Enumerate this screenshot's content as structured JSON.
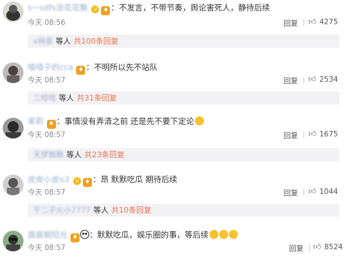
{
  "comments": [
    {
      "username": "s一sdfs涂花花飘",
      "text": "不发言，不带节奏，舆论害死人，静待后续",
      "time": "今天 08:56",
      "reply": "回复",
      "likes": "4275",
      "sub": {
        "name": "x林泉",
        "deng": "等人",
        "total": "共100条回复"
      }
    },
    {
      "username": "嘻嘻子的cca",
      "text": "不明所以先不站队",
      "time": "今天 08:57",
      "reply": "回复",
      "likes": "2534",
      "sub": {
        "name": "二哈哈",
        "deng": "等人",
        "total": "共31条回复"
      }
    },
    {
      "username": "茉莉",
      "text": "事情没有弄清之前 还是先不要下定论",
      "time": "今天 08:57",
      "reply": "回复",
      "likes": "1675",
      "sub": {
        "name": "天梦飘飘",
        "deng": "等人",
        "total": "共23条回复"
      }
    },
    {
      "username": "皮皮小皮o3",
      "text": "昂 默默吃瓜 期待后续",
      "time": "今天 08:57",
      "reply": "回复",
      "likes": "1044",
      "sub": {
        "name": "干二子火小7777",
        "deng": "等人",
        "total": "共10条回复"
      }
    },
    {
      "username": "晨晨朝阳光",
      "text": "默默吃瓜，娱乐圈的事，等后续",
      "time": "今天 08:57",
      "reply": "回复",
      "likes": "8524"
    }
  ]
}
